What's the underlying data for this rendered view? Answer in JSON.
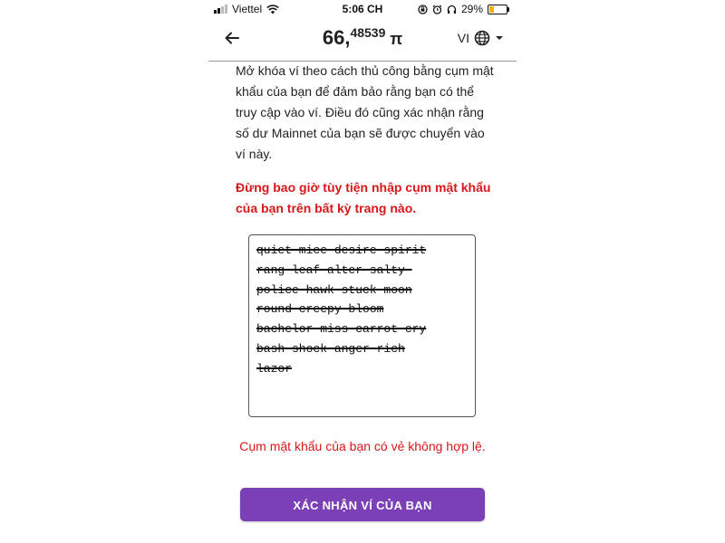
{
  "status_bar": {
    "carrier": "Viettel",
    "time": "5:06 CH",
    "battery_percent": "29%",
    "battery_level": 0.29
  },
  "header": {
    "balance_whole": "66,",
    "balance_fraction": "48539",
    "currency_symbol": "π",
    "language": "VI"
  },
  "main": {
    "intro_text": "Mở khóa ví theo cách thủ công bằng cụm mật khẩu của bạn để đảm bảo rằng bạn có thể truy cập vào ví. Điều đó cũng xác nhận rằng số dư Mainnet của bạn sẽ được chuyển vào ví này.",
    "warning_text": "Đừng bao giờ tùy tiện nhập cụm mật khẩu của bạn trên bất kỳ trang nào.",
    "passphrase_lines": [
      "quiet mice desire spirit",
      "rang leaf alter salty ",
      "police hawk stuck moon",
      "round creepy bloom",
      "bachelor miss carrot cry",
      "bash shock anger rich",
      "lazor"
    ],
    "error_text": "Cụm mật khẩu của bạn có vẻ không hợp lệ.",
    "confirm_label": "XÁC NHẬN VÍ CỦA BẠN"
  },
  "icons": {
    "back": "arrow-left-icon",
    "globe": "globe-icon",
    "dropdown": "caret-down-icon"
  },
  "colors": {
    "accent": "#7b3fb6",
    "warning": "#d8171a",
    "battery": "#f0b400"
  }
}
